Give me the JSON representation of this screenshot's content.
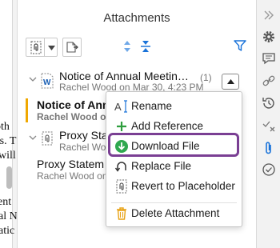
{
  "document": {
    "lines": [
      "oth",
      "rs. T",
      "will",
      "ent",
      "al N",
      "atic"
    ]
  },
  "panel": {
    "title": "Attachments",
    "toolbar": {
      "attach_icon": "paperclip-doc-icon",
      "import_icon": "import-document-icon",
      "sort_icon": "sort-icon",
      "collapse_icon": "collapse-all-icon",
      "filter_icon": "filter-icon"
    }
  },
  "attachments": [
    {
      "title": "Notice of Annual Meetin…",
      "meta": "Rachel Wood on Mar 30, 4:23 PM",
      "count": "(1)",
      "icon": "word-file-icon"
    },
    {
      "title": "Notice of Ann",
      "meta": "Rachel Wood on"
    },
    {
      "title": "Proxy State",
      "meta": "Rachel Wood on"
    },
    {
      "title": "Proxy Statem",
      "meta": "Rachel Wood on"
    }
  ],
  "menu": {
    "items": [
      {
        "label": "Rename",
        "icon": "rename-icon"
      },
      {
        "label": "Add Reference",
        "icon": "add-icon"
      },
      {
        "label": "Download File",
        "icon": "download-icon"
      },
      {
        "label": "Replace File",
        "icon": "replace-icon"
      },
      {
        "label": "Revert to Placeholder",
        "icon": "placeholder-icon"
      },
      {
        "label": "Delete Attachment",
        "icon": "trash-icon"
      }
    ],
    "highlight_color": "#7a3f93"
  },
  "colors": {
    "accent_blue": "#1a73d9",
    "selection_yellow": "#f0a800",
    "add_green": "#2e9e3e",
    "download_green": "#2fa84f",
    "delete_orange": "#e8a317"
  }
}
